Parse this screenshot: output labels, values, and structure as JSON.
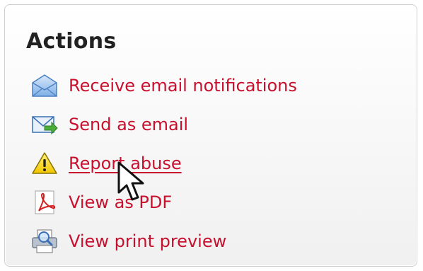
{
  "panel": {
    "title": "Actions"
  },
  "actions": [
    {
      "icon": "envelope-icon",
      "label": "Receive email notifications"
    },
    {
      "icon": "email-send-icon",
      "label": "Send as email"
    },
    {
      "icon": "warning-icon",
      "label": "Report abuse"
    },
    {
      "icon": "pdf-icon",
      "label": "View as PDF"
    },
    {
      "icon": "print-preview-icon",
      "label": "View print preview"
    }
  ],
  "colors": {
    "link": "#c8102e",
    "title": "#222222",
    "panel_border": "#cfcfcf"
  }
}
